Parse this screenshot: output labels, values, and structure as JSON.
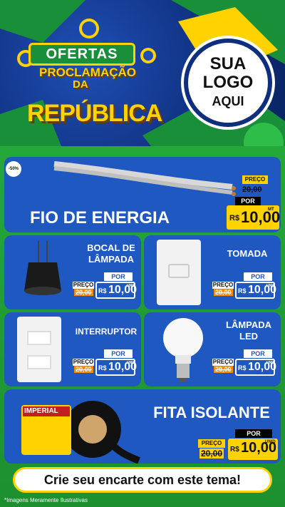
{
  "header": {
    "ofertas": "OFERTAS",
    "proclamacao": "PROCLAMAÇÃO",
    "da": "DA",
    "republica": "REPÚBLICA",
    "logo_line1": "SUA",
    "logo_line2": "LOGO",
    "logo_line3": "AQUI"
  },
  "badge": "-50%",
  "products": {
    "fio": {
      "name": "FIO DE ENERGIA",
      "preco_label": "PREÇO",
      "old_price": "20,00",
      "por_label": "POR",
      "currency": "R$",
      "price": "10,00",
      "unit": "MT"
    },
    "bocal": {
      "name_line1": "BOCAL DE",
      "name_line2": "LÂMPADA",
      "preco_label": "PREÇO",
      "old_price": "20,00",
      "por_label": "POR",
      "currency": "R$",
      "price": "10,00",
      "unit": "UNID"
    },
    "tomada": {
      "name": "TOMADA",
      "preco_label": "PREÇO",
      "old_price": "20,00",
      "por_label": "POR",
      "currency": "R$",
      "price": "10,00",
      "unit": "UNID"
    },
    "interruptor": {
      "name": "INTERRUPTOR",
      "preco_label": "PREÇO",
      "old_price": "20,00",
      "por_label": "POR",
      "currency": "R$",
      "price": "10,00",
      "unit": "UNID"
    },
    "lampada": {
      "name_line1": "LÂMPADA",
      "name_line2": "LED",
      "preco_label": "PREÇO",
      "old_price": "20,00",
      "por_label": "POR",
      "currency": "R$",
      "price": "10,00",
      "unit": "UNID"
    },
    "fita": {
      "name": "FITA ISOLANTE",
      "brand": "IMPERIAL",
      "preco_label": "PREÇO",
      "old_price": "20,00",
      "por_label": "POR",
      "currency": "R$",
      "price": "10,00",
      "unit": "UNID"
    }
  },
  "footer": {
    "cta": "Crie seu encarte com este tema!",
    "disclaimer": "*Imagens Meramente Ilustrativas"
  }
}
